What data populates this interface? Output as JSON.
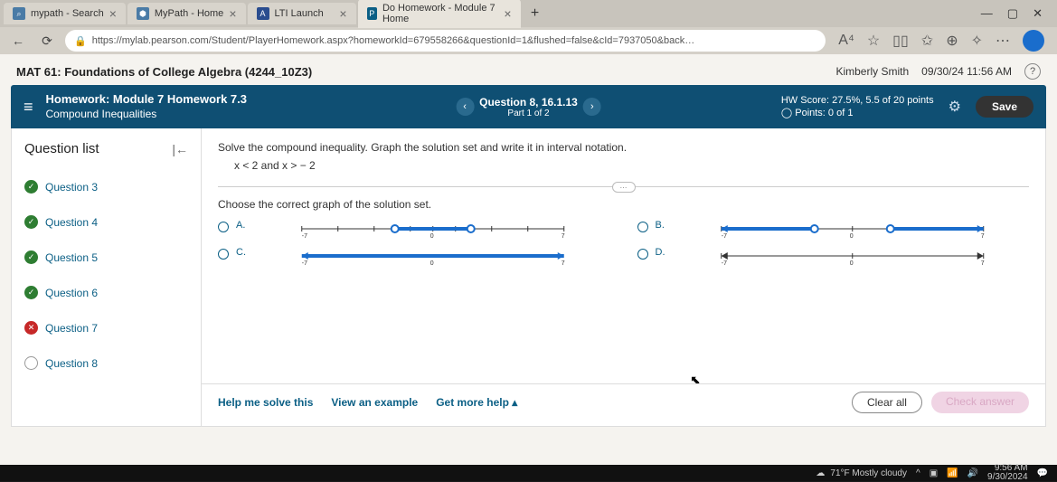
{
  "browser": {
    "tabs": [
      {
        "title": "mypath - Search",
        "icon": "⌕"
      },
      {
        "title": "MyPath - Home",
        "icon": "⬢"
      },
      {
        "title": "LTI Launch",
        "icon": "A"
      },
      {
        "title": "Do Homework - Module 7 Home",
        "icon": "P",
        "active": true
      }
    ],
    "url": "https://mylab.pearson.com/Student/PlayerHomework.aspx?homeworkId=679558266&questionId=1&flushed=false&cId=7937050&back…",
    "lock_label": "🔒"
  },
  "course": {
    "title": "MAT 61: Foundations of College Algebra (4244_10Z3)",
    "user": "Kimberly Smith",
    "datetime": "09/30/24 11:56 AM"
  },
  "homework_bar": {
    "line1": "Homework:  Module 7 Homework 7.3",
    "line2": "Compound Inequalities",
    "question_label": "Question 8, 16.1.13",
    "part_label": "Part 1 of 2",
    "score_line": "HW Score: 27.5%, 5.5 of 20 points",
    "points_line": "Points: 0 of 1",
    "save": "Save"
  },
  "question_list": {
    "title": "Question list",
    "items": [
      {
        "label": "Question 3",
        "status": "ok"
      },
      {
        "label": "Question 4",
        "status": "ok"
      },
      {
        "label": "Question 5",
        "status": "ok"
      },
      {
        "label": "Question 6",
        "status": "ok"
      },
      {
        "label": "Question 7",
        "status": "bad"
      },
      {
        "label": "Question 8",
        "status": "none"
      }
    ]
  },
  "problem": {
    "instruction": "Solve the compound inequality. Graph the solution set and write it in interval notation.",
    "expression": "x < 2 and x > − 2",
    "choose": "Choose the correct graph of the solution set.",
    "options": {
      "a": "A.",
      "b": "B.",
      "c": "C.",
      "d": "D."
    },
    "ticks": {
      "left": "-7",
      "mid": "0",
      "right": "7"
    }
  },
  "footer": {
    "help": "Help me solve this",
    "example": "View an example",
    "more": "Get more help ▴",
    "clear": "Clear all",
    "check": "Check answer"
  },
  "taskbar": {
    "weather": "71°F Mostly cloudy",
    "time": "9:56 AM",
    "date": "9/30/2024"
  }
}
